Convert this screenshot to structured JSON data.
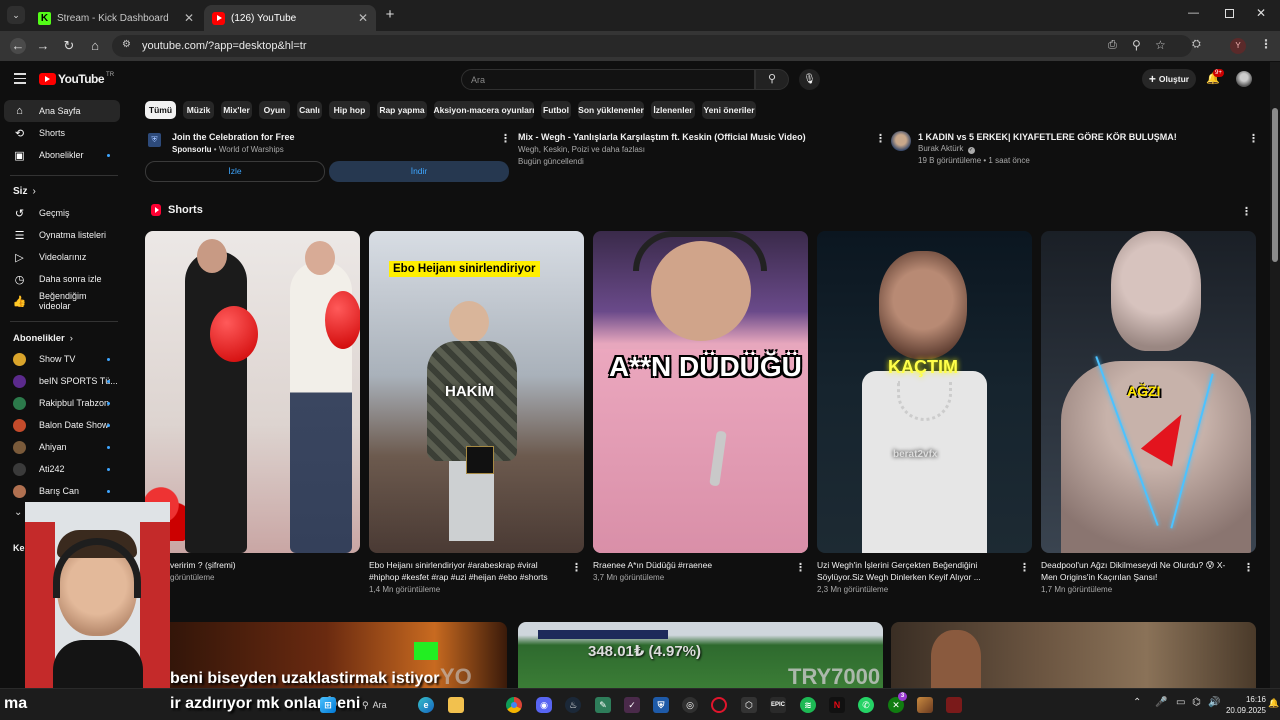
{
  "browser": {
    "tabs": [
      {
        "title": "Stream - Kick Dashboard",
        "icon": "kick-logo-icon"
      },
      {
        "title": "(126) YouTube",
        "icon": "youtube-logo-icon"
      }
    ],
    "url": "youtube.com/?app=desktop&hl=tr",
    "profile_initial": "Y"
  },
  "yt": {
    "logo_text": "YouTube",
    "country": "TR",
    "search_placeholder": "Ara",
    "create_label": "Oluştur",
    "notif_count": "9+"
  },
  "sidebar": {
    "main": [
      {
        "label": "Ana Sayfa",
        "icon": "home-icon"
      },
      {
        "label": "Shorts",
        "icon": "shorts-icon"
      },
      {
        "label": "Abonelikler",
        "icon": "subscriptions-icon"
      }
    ],
    "you_header": "Siz",
    "you": [
      {
        "label": "Geçmiş",
        "icon": "history-icon"
      },
      {
        "label": "Oynatma listeleri",
        "icon": "playlist-icon"
      },
      {
        "label": "Videolarınız",
        "icon": "your-videos-icon"
      },
      {
        "label": "Daha sonra izle",
        "icon": "watch-later-icon"
      },
      {
        "label": "Beğendiğim videolar",
        "icon": "like-icon"
      }
    ],
    "subs_header": "Abonelikler",
    "subs": [
      {
        "label": "Show TV",
        "color": "#d9a42b"
      },
      {
        "label": "beIN SPORTS Tü...",
        "color": "#5b2a8c"
      },
      {
        "label": "Rakipbul Trabzon",
        "color": "#2c7a4b"
      },
      {
        "label": "Balon Date Show",
        "color": "#c44b2b"
      },
      {
        "label": "Ahiyan",
        "color": "#7a5a3a"
      },
      {
        "label": "Ati242",
        "color": "#3a3a3a"
      },
      {
        "label": "Barış Can",
        "color": "#b07050"
      }
    ],
    "explore_header": "Ke"
  },
  "chips": [
    "Tümü",
    "Müzik",
    "Mix'ler",
    "Oyun",
    "Canlı",
    "Hip hop",
    "Rap yapma",
    "Aksiyon-macera oyunları",
    "Futbol",
    "Son yüklenenler",
    "İzlenenler",
    "Yeni öneriler"
  ],
  "top_row": {
    "ad": {
      "title": "Join the Celebration for Free",
      "sponsor": "Sponsorlu",
      "advertiser": "World of Warships",
      "watch_btn": "İzle",
      "download_btn": "İndir"
    },
    "mix": {
      "title": "Mix - Wegh - Yanlışlarla Karşılaştım ft. Keskin (Official Music Video)",
      "sub": "Wegh, Keskin, Poizi ve daha fazlası",
      "updated": "Bugün güncellendi"
    },
    "video": {
      "title": "1 KADIN vs 5 ERKEK| KIYAFETLERE GÖRE KÖR BULUŞMA!",
      "channel": "Burak Aktürk",
      "meta": "19 B görüntüleme • 1 saat önce"
    }
  },
  "shorts_header": "Shorts",
  "shorts": [
    {
      "title": "veririm ? (şifremi)",
      "line2": "",
      "views": "görüntüleme",
      "overlay": ""
    },
    {
      "title": "Ebo Heijanı sinirlendiriyor  #arabeskrap #viral",
      "line2": "#hiphop #kesfet #rap #uzi #heijan #ebo #shorts",
      "views": "1,4 Mn görüntüleme",
      "overlay": "Ebo Heijanı sinirlendiriyor",
      "overlay2": "HAKİM"
    },
    {
      "title": "Rraenee A*ın Düdüğü  #rraenee",
      "line2": "",
      "views": "3,7 Mn görüntüleme",
      "overlay": "A**N DÜDÜĞÜ"
    },
    {
      "title": "Uzi Wegh'in İşlerini Gerçekten Beğendiğini",
      "line2": "Söylüyor.Siz Wegh Dinlerken Keyif Alıyor ...",
      "views": "2,3 Mn görüntüleme",
      "overlay": "KAÇTIM",
      "overlay2": "berat2vfx"
    },
    {
      "title": "Deadpool'un Ağzı Dikilmeseydi Ne Olurdu? 😰 X-",
      "line2": "Men Origins'in Kaçırılan Şansı!",
      "views": "1,7 Mn görüntüleme",
      "overlay": "AĞZI"
    }
  ],
  "stream_overlay": {
    "caption1": "beni biseyden uzaklastirmak istiyor",
    "caption2": "ir azdırıyor mk onlar beni",
    "caption_prefix": "ma",
    "price": "348.01₺ (4.97%)",
    "tile_text": "TRY7000",
    "tile_text2": "YO"
  },
  "taskbar": {
    "search_label": "Ara",
    "time": "16:16",
    "date": "20.09.2025",
    "badge": "3"
  }
}
